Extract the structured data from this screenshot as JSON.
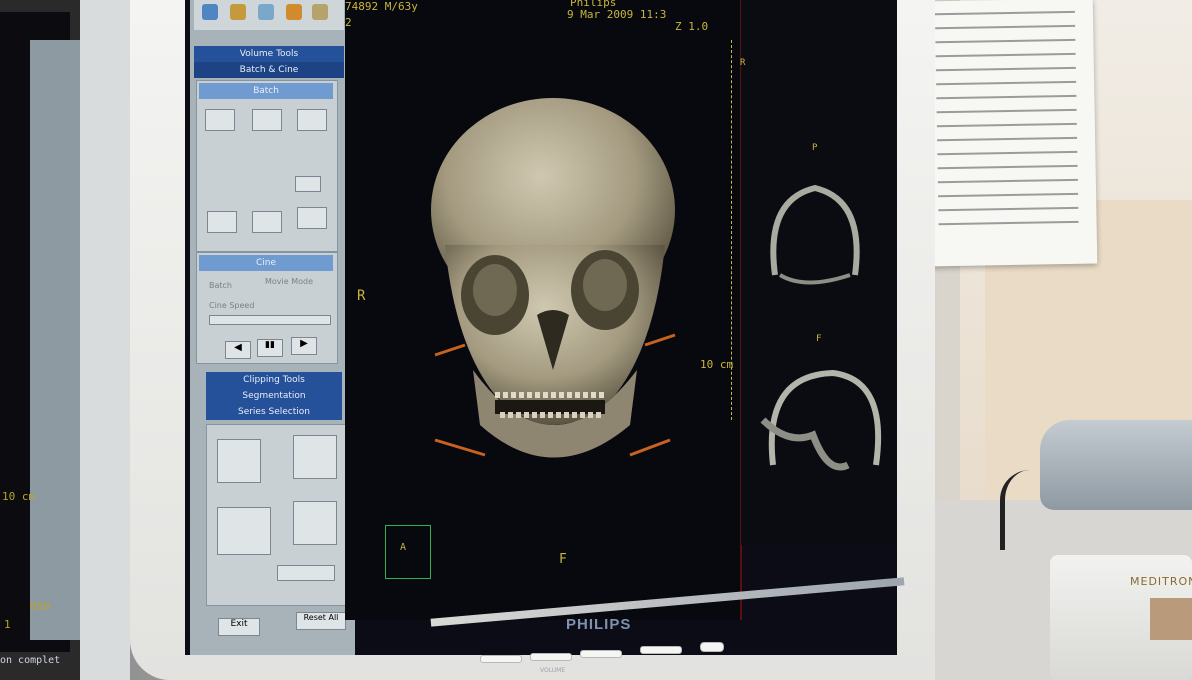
{
  "scene": {
    "description_colors": {
      "accent_blue": "#24519a",
      "overlay_text": "#c9b63d",
      "bone": "#c9c1a8"
    }
  },
  "overlay": {
    "patient": "74892 M/63y",
    "scanner": "Philips",
    "datetime": "9 Mar 2009 11:3",
    "line2_left": "2",
    "line2_right": "Z 1.0",
    "orient_r": "R",
    "orient_f": "F",
    "scale": "10 cm",
    "cube_a": "A",
    "right_r": "R",
    "right_p": "P",
    "right_f": "F",
    "left_scale": "10 cm",
    "left_val1": "650",
    "left_val2": "1",
    "left_status": "on complet"
  },
  "panel": {
    "volume_tools": "Volume Tools",
    "batch_cine": "Batch & Cine",
    "batch": "Batch",
    "cine": "Cine",
    "batch_opt": "Batch",
    "movie_mode": "Movie Mode",
    "cine_speed": "Cine Speed",
    "clipping_tools": "Clipping Tools",
    "segmentation": "Segmentation",
    "series_selection": "Series Selection",
    "exit": "Exit",
    "reset_all": "Reset All"
  },
  "monitor": {
    "brand": "PHILIPS",
    "volume_label": "VOLUME"
  },
  "device": {
    "brand": "MEDITRON"
  }
}
